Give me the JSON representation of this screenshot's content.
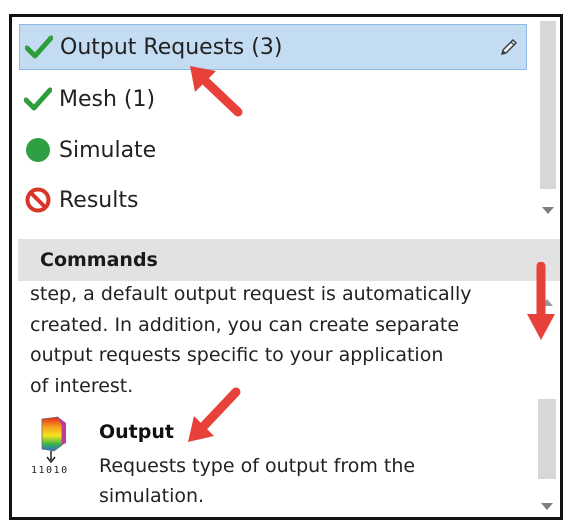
{
  "tree": {
    "items": [
      {
        "label": "Output Requests (3)",
        "status": "check"
      },
      {
        "label": "Mesh (1)",
        "status": "check"
      },
      {
        "label": "Simulate",
        "status": "ready"
      },
      {
        "label": "Results",
        "status": "blocked"
      }
    ]
  },
  "commands": {
    "header": "Commands",
    "description_lines": [
      "step, a default output request is automatically",
      "created. In addition, you can create separate",
      "output requests specific to your application",
      "of interest."
    ],
    "item": {
      "icon_caption": "11010",
      "name": "Output",
      "description_lines": [
        "Requests type of output from the",
        "simulation."
      ]
    }
  },
  "colors": {
    "selected_bg": "#c4dcf2",
    "check_green": "#2e9e3a",
    "ready_green": "#2ea043",
    "blocked_red": "#d9362b",
    "annotation_arrow": "#e8413a"
  }
}
